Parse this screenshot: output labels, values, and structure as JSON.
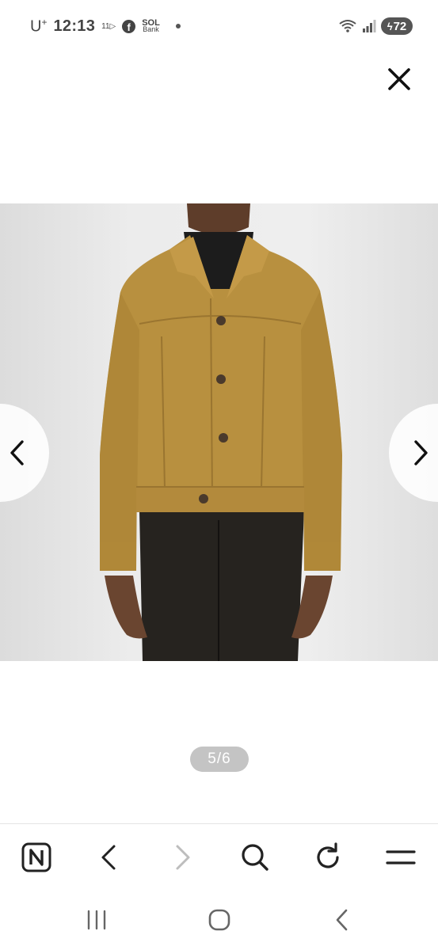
{
  "status_bar": {
    "carrier": "U",
    "carrier_sup": "+",
    "time": "12:13",
    "app_badge": "11▷",
    "sol_top": "SOL",
    "sol_bottom": "Bank",
    "battery": "72"
  },
  "viewer": {
    "counter": "5/6",
    "image_alt": "Tan suede trucker jacket worn by model"
  },
  "icons": {
    "close": "close-icon",
    "prev": "chevron-left-icon",
    "next": "chevron-right-icon",
    "naver": "naver-n-icon",
    "back": "back-icon",
    "forward": "forward-icon",
    "search": "search-icon",
    "reload": "reload-icon",
    "menu": "menu-icon",
    "recent_apps": "recent-apps-icon",
    "home": "home-icon",
    "system_back": "system-back-icon"
  },
  "colors": {
    "jacket": "#b8903f",
    "shirt": "#1c1c1c",
    "trousers": "#26231f",
    "skin": "#6a4530",
    "toolbar_icon": "#222222",
    "disabled_icon": "#bdbdbd"
  }
}
